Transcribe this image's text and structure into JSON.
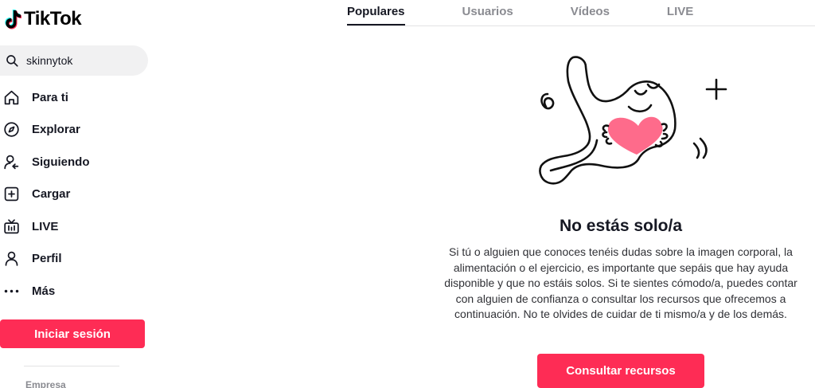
{
  "app": {
    "name": "TikTok"
  },
  "search": {
    "value": "skinnytok"
  },
  "nav": {
    "items": [
      {
        "label": "Para ti",
        "icon": "home-icon"
      },
      {
        "label": "Explorar",
        "icon": "compass-icon"
      },
      {
        "label": "Siguiendo",
        "icon": "following-icon"
      },
      {
        "label": "Cargar",
        "icon": "upload-icon"
      },
      {
        "label": "LIVE",
        "icon": "live-tv-icon"
      },
      {
        "label": "Perfil",
        "icon": "profile-icon"
      },
      {
        "label": "Más",
        "icon": "more-icon"
      }
    ]
  },
  "login": {
    "label": "Iniciar sesión"
  },
  "footer": {
    "empresa": "Empresa"
  },
  "tabs": [
    {
      "label": "Populares",
      "active": true
    },
    {
      "label": "Usuarios",
      "active": false
    },
    {
      "label": "Vídeos",
      "active": false
    },
    {
      "label": "LIVE",
      "active": false
    }
  ],
  "notice": {
    "title": "No estás solo/a",
    "description": "Si tú o alguien que conoces tenéis dudas sobre la imagen corporal, la alimentación o el ejercicio, es importante que sepáis que hay ayuda disponible y que no estáis solos. Si te sientes cómodo/a, puedes contar con alguien de confianza o consultar los recursos que ofrecemos a continuación. No te olvides de cuidar de ti mismo/a y de los demás.",
    "button_label": "Consultar recursos",
    "illustration": "stomach-hugging-heart-illustration"
  },
  "colors": {
    "accent": "#fe2c55",
    "text_primary": "#161823",
    "text_muted": "#8a8b91",
    "heart": "#fe6b8b"
  }
}
